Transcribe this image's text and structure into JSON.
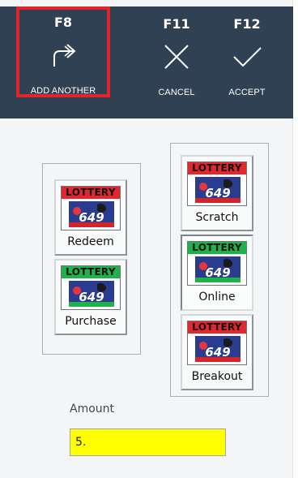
{
  "toolbar": {
    "add_another": {
      "key": "F8",
      "label": "ADD ANOTHER",
      "icon": "redirect-arrow-icon"
    },
    "cancel": {
      "key": "F11",
      "label": "CANCEL",
      "icon": "x-icon"
    },
    "accept": {
      "key": "F12",
      "label": "ACCEPT",
      "icon": "checkmark-icon"
    }
  },
  "logo_text": "LOTTERY",
  "logo_numbers": "649",
  "tickets": {
    "redeem": {
      "label": "Redeem",
      "band_color": "#e2272e"
    },
    "purchase": {
      "label": "Purchase",
      "band_color": "#1fb24b"
    },
    "scratch": {
      "label": "Scratch",
      "band_color": "#e2272e"
    },
    "online": {
      "label": "Online",
      "band_color": "#1fb24b",
      "selected": true
    },
    "breakout": {
      "label": "Breakout",
      "band_color": "#e2272e"
    }
  },
  "amount": {
    "label": "Amount",
    "value": "5."
  },
  "colors": {
    "toolbar_bg": "#2f4152",
    "highlight_border": "#e3242b",
    "amount_bg": "#ffff00"
  }
}
